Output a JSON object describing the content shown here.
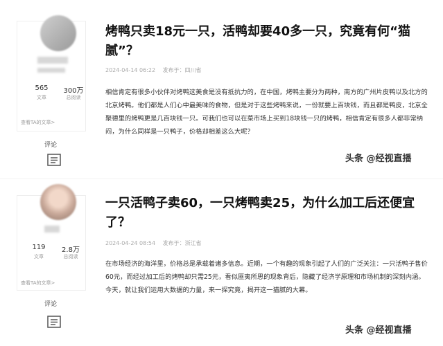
{
  "articles": [
    {
      "author_stats": {
        "articles_count": "565",
        "articles_label": "文章",
        "reads_count": "300万",
        "reads_label": "总阅读",
        "see_articles": "查看TA的文章>"
      },
      "comment_label": "评论",
      "title": "烤鸭只卖18元一只，活鸭却要40多一只，究竟有何“猫腻”？",
      "meta": {
        "date": "2024-04-14 06:22",
        "location": "发布于：四川省"
      },
      "body": "相信肯定有很多小伙伴对烤鸭这美食是没有抵抗力的，在中国，烤鸭主要分为两种，南方的广州片皮鸭以及北方的北京烤鸭。他们都是人们心中最美味的食物，但是对于这些烤鸭来说，一份就要上百块钱，而且都是鸭皮，北京全聚德里的烤鸭更是几百块钱一只。可我们也可以在菜市场上买到18块钱一只的烤鸭，相信肯定有很多人都非常纳闷，为什么同样是一只鸭子，价格却相差这么大呢？",
      "watermark": "头条 @经视直播"
    },
    {
      "author_stats": {
        "articles_count": "119",
        "articles_label": "文章",
        "reads_count": "2.8万",
        "reads_label": "总阅读",
        "see_articles": "查看TA的文章>"
      },
      "comment_label": "评论",
      "title": "一只活鸭子卖60，一只烤鸭卖25，为什么加工后还便宜了？",
      "meta": {
        "date": "2024-04-24 08:54",
        "location": "发布于：浙江省"
      },
      "body": "在市场经济的海洋里，价格总是承载着诸多信息。近期，一个有趣的现象引起了人们的广泛关注：一只活鸭子售价60元，而经过加工后的烤鸭却只需25元，看似匪夷所思的现象背后，隐藏了经济学原理和市场机制的深刻内涵。今天，就让我们运用大数据的力量，来一探究竟，揭开这一猫腻的大幕。",
      "watermark": "头条 @经视直播"
    }
  ],
  "icons": {
    "comment": "comment-icon"
  }
}
